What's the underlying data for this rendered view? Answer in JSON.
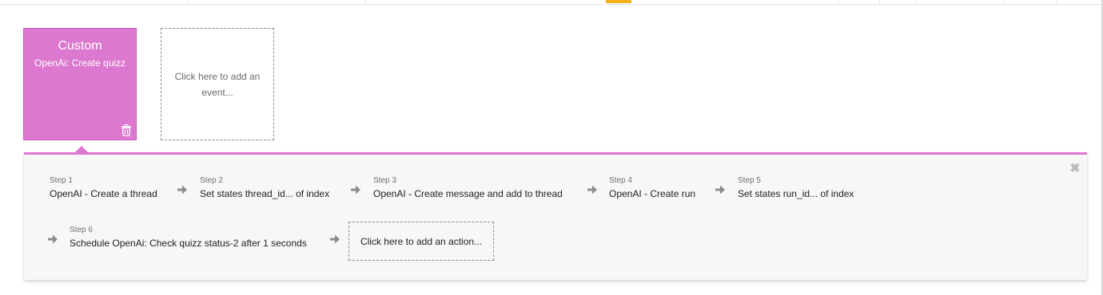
{
  "events": {
    "custom": {
      "type_label": "Custom",
      "name": "OpenAi: Create quizz",
      "accent_color": "#dc78cf",
      "delete_icon": "trash-icon"
    },
    "add_event_label": "Click here to add an event..."
  },
  "workflow": {
    "close_icon": "close-icon",
    "steps": [
      {
        "num": "Step 1",
        "title": "OpenAI - Create a thread"
      },
      {
        "num": "Step 2",
        "title": "Set states thread_id... of index"
      },
      {
        "num": "Step 3",
        "title": "OpenAI - Create message and add to thread"
      },
      {
        "num": "Step 4",
        "title": "OpenAI - Create run"
      },
      {
        "num": "Step 5",
        "title": "Set states run_id... of index"
      },
      {
        "num": "Step 6",
        "title": "Schedule OpenAi: Check quizz status-2 after 1 seconds"
      }
    ],
    "add_action_label": "Click here to add an action..."
  }
}
